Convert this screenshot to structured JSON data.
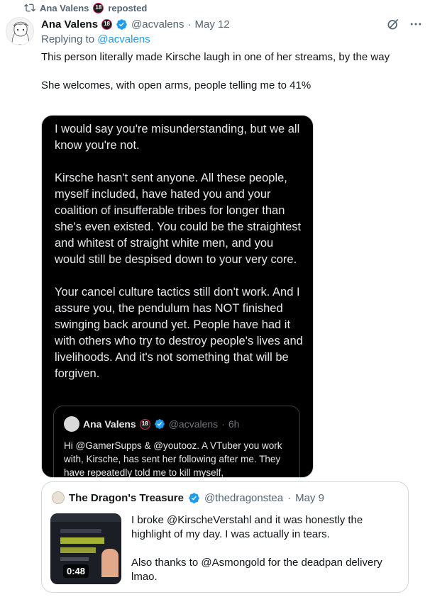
{
  "repost": {
    "icon": "repost-icon",
    "user": "Ana Valens",
    "age_badge": "18",
    "label": "reposted"
  },
  "post": {
    "author_name": "Ana Valens",
    "age_badge": "18",
    "verified_icon": "verified-badge-icon",
    "handle": "@acvalens",
    "separator": "·",
    "date": "May 12",
    "replying_to_label": "Replying to",
    "replying_to_handle": "@acvalens",
    "text_paragraphs": [
      "This person literally made Kirsche laugh in one of her streams, by the way",
      "She welcomes, with open arms, people telling me to 41%"
    ]
  },
  "media": {
    "paragraphs": [
      "I would say you're misunderstanding, but we all know you're not.",
      "Kirsche hasn't sent anyone.  All these people, myself included, have hated you and your coalition of insufferable tribes for longer than she's even existed.  You could be the straightest and whitest of straight white men, and you would still be despised down to your very core.",
      "Your cancel culture tactics still don't work. And I assure you, the pendulum has NOT finished swinging back around yet.  People have had it with others who try to destroy people's lives and livelihoods.  And it's not something that will be forgiven."
    ],
    "inner_card": {
      "author_name": "Ana Valens",
      "age_badge": "18",
      "handle": "@acvalens",
      "separator": "·",
      "time": "6h",
      "text": "Hi @GamerSupps & @youtooz. A VTuber you work with, Kirsche, has sent her following after me. They have repeatedly told me to kill myself,"
    }
  },
  "quote": {
    "author_name": "The Dragon's Treasure",
    "handle": "@thedragonstea",
    "separator": "·",
    "date": "May 9",
    "video_duration": "0:48",
    "text_paragraphs": [
      "I broke @KirscheVerstahl and it was honestly the highlight of my day. I was actually in tears.",
      "Also thanks to @Asmongold for the deadpan delivery lmao."
    ]
  },
  "colors": {
    "text_primary": "#0f1419",
    "text_secondary": "#536471",
    "link": "#1d9bf0",
    "verified": "#1d9bf0",
    "media_bg": "#000000"
  }
}
